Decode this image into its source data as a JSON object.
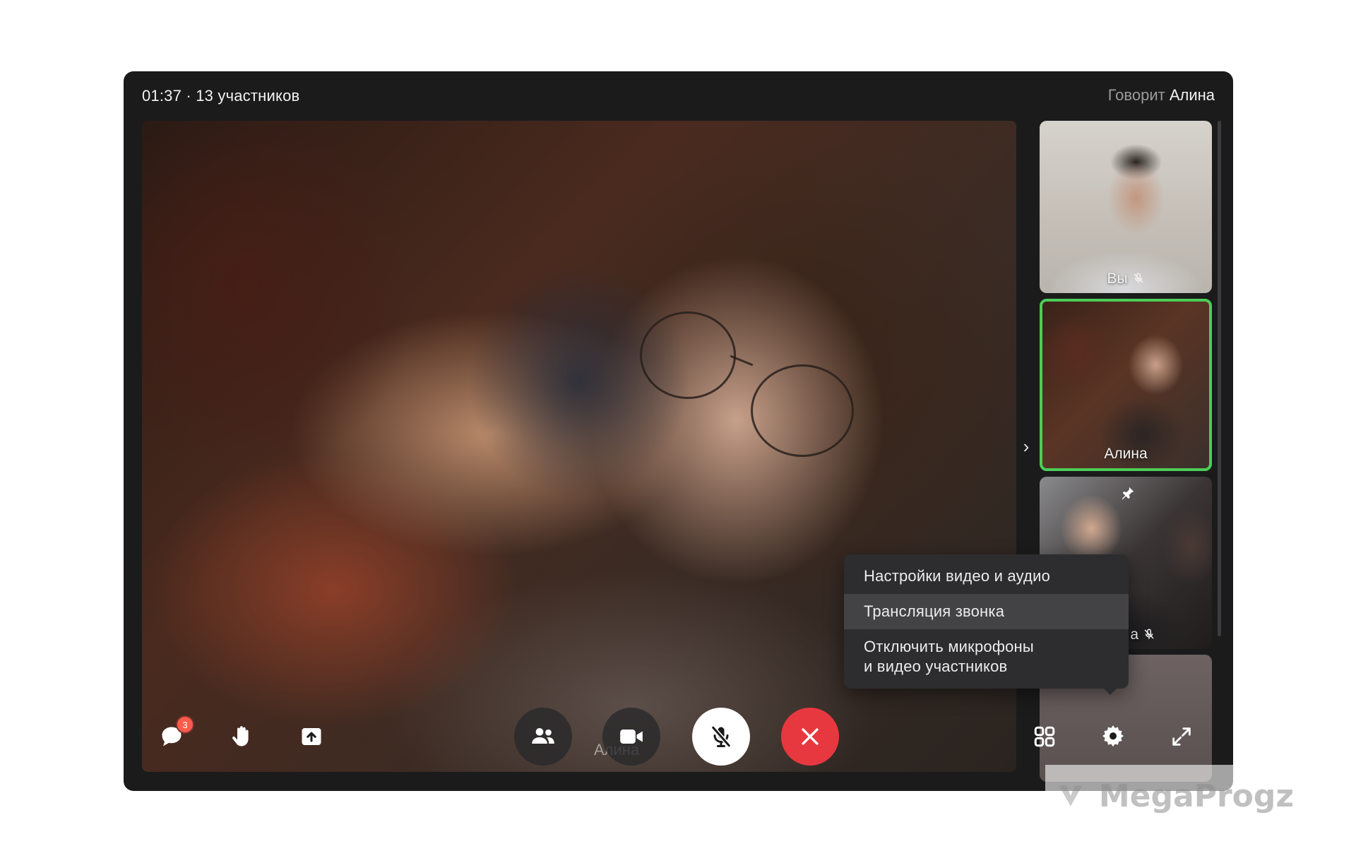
{
  "header": {
    "call_info": "01:37 · 13 участников",
    "speaker_prefix": "Говорит",
    "speaker_name": "Алина"
  },
  "main_video": {
    "participant_name": "Алина"
  },
  "participants": [
    {
      "label": "Вы",
      "muted": true,
      "speaking": false
    },
    {
      "label": "Алина",
      "muted": false,
      "speaking": true
    },
    {
      "label": "а",
      "muted": true,
      "speaking": false,
      "pinned": true
    }
  ],
  "context_menu": {
    "items": [
      {
        "label": "Настройки видео и аудио",
        "active": false
      },
      {
        "label": "Трансляция звонка",
        "active": true
      },
      {
        "label": "Отключить микрофоны\nи видео участников",
        "active": false
      }
    ]
  },
  "toolbar": {
    "chat_badge": "3",
    "icons": [
      "chat-icon",
      "raise-hand-icon",
      "share-screen-icon",
      "participants-icon",
      "camera-icon",
      "microphone-muted-icon",
      "end-call-icon",
      "grid-layout-icon",
      "settings-icon",
      "fullscreen-icon"
    ]
  },
  "colors": {
    "window_bg": "#1b1b1c",
    "speaking_border": "#4ccd57",
    "end_call": "#e8383f",
    "badge": "#ff5b4a"
  },
  "watermark": {
    "text": "MegaProgz"
  }
}
